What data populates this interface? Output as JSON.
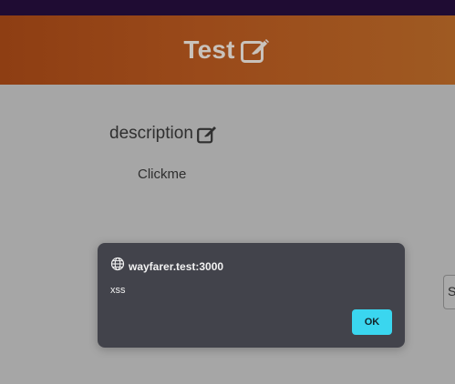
{
  "header": {
    "title": "Test",
    "edit_icon": "edit-icon"
  },
  "content": {
    "description_label": "description",
    "description_edit_icon": "edit-icon",
    "clickme_text": "Clickme"
  },
  "side_button": {
    "label": "S"
  },
  "dialog": {
    "icon": "globe-icon",
    "origin": "wayfarer.test:3000",
    "message": "xss",
    "ok_label": "OK"
  },
  "colors": {
    "top_strip": "#1f0c33",
    "banner_start": "#8e3e13",
    "banner_end": "#9f5a22",
    "overlay_background": "#a6a6a6",
    "dialog_background": "#42434b",
    "ok_button": "#3ad6ef"
  }
}
